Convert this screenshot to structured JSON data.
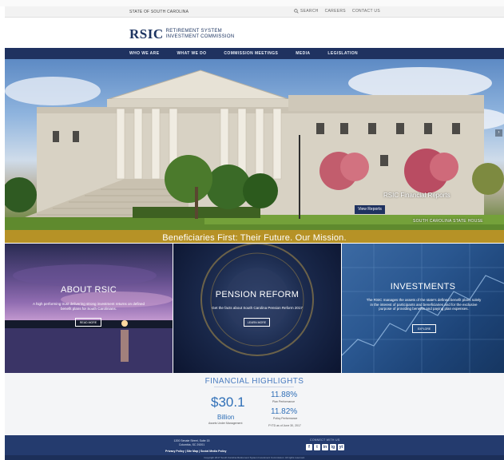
{
  "utility": {
    "state_label": "STATE OF SOUTH CAROLINA",
    "search_label": "SEARCH",
    "careers_label": "CAREERS",
    "contact_label": "CONTACT US"
  },
  "header": {
    "logo_mark": "RSIC",
    "logo_line1": "RETIREMENT SYSTEM",
    "logo_line2": "INVESTMENT COMMISSION"
  },
  "nav": {
    "items": [
      {
        "label": "WHO WE ARE"
      },
      {
        "label": "WHAT WE DO"
      },
      {
        "label": "COMMISSION MEETINGS"
      },
      {
        "label": "MEDIA"
      },
      {
        "label": "LEGISLATION"
      }
    ]
  },
  "hero": {
    "caption_title": "RSIC Financial Reports",
    "caption_button": "View Reports",
    "location": "SOUTH CAROLINA STATE HOUSE",
    "tagline": "Beneficiaries First: Their Future. Our Mission."
  },
  "panels": {
    "about": {
      "title": "ABOUT RSIC",
      "desc": "A high performing trust delivering strong investment returns on defined benefit plans for South Carolinians.",
      "button": "READ MORE"
    },
    "pension": {
      "title": "PENSION REFORM",
      "desc": "Get the facts about South Carolina Pension Reform 2017",
      "button": "LEARN MORE"
    },
    "investments": {
      "title": "INVESTMENTS",
      "desc": "The RSIC manages the assets of the state's defined benefit plans solely in the interest of participants and beneficiaries and for the exclusive purpose of providing benefits and paying plan expenses.",
      "button": "EXPLORE"
    }
  },
  "financial": {
    "title": "FINANCIAL HIGHLIGHTS",
    "aum_value": "$30.1",
    "aum_unit": "Billion",
    "aum_label": "Assets Under Management",
    "stat1_value": "11.88%",
    "stat1_label": "Plan Performance",
    "stat2_value": "11.82%",
    "stat2_label": "Policy Performance",
    "as_of": "FYTD as of June 30, 2017"
  },
  "footer": {
    "address_line1": "1200 Senate Street, Suite 15",
    "address_line2": "Columbia, SC 29201",
    "policies": "Privacy Policy | Site Map | Social Media Policy",
    "connect": "CONNECT WITH US",
    "social": [
      "f",
      "t",
      "in",
      "ig",
      "yt"
    ],
    "copyright": "Copyright 2017 South Carolina Retirement System Investment Commission. All rights reserved."
  }
}
